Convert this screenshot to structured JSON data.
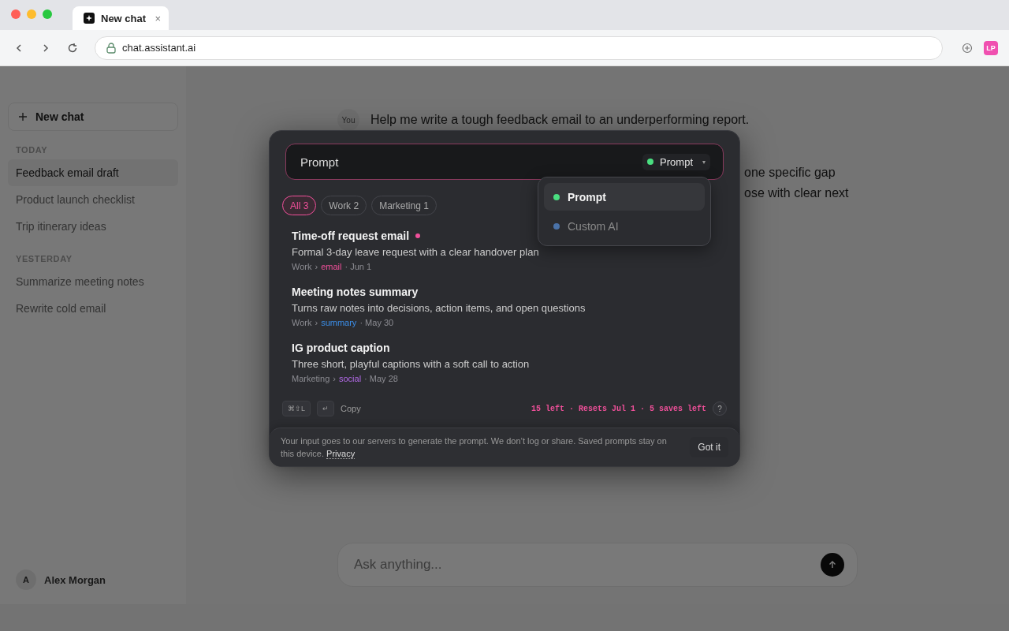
{
  "browser": {
    "tab_title": "New chat",
    "tab_close": "×",
    "url": "chat.assistant.ai",
    "extension_label": "LP"
  },
  "sidebar": {
    "new_chat": "New chat",
    "sections": [
      {
        "heading": "TODAY",
        "items": [
          {
            "label": "Feedback email draft",
            "selected": true
          },
          {
            "label": "Product launch checklist",
            "selected": false
          },
          {
            "label": "Trip itinerary ideas",
            "selected": false
          }
        ]
      },
      {
        "heading": "YESTERDAY",
        "items": [
          {
            "label": "Summarize meeting notes",
            "selected": false
          },
          {
            "label": "Rewrite cold email",
            "selected": false
          }
        ]
      }
    ],
    "user": {
      "initial": "A",
      "name": "Alex Morgan"
    }
  },
  "chat": {
    "message": {
      "avatar": "You",
      "text": "Help me write a tough feedback email to an underperforming report."
    },
    "reply_fragments": [
      "one specific gap",
      "ose with clear next"
    ],
    "composer": {
      "placeholder": "Ask anything..."
    }
  },
  "modal": {
    "search": {
      "value": "Prompt"
    },
    "mode_select": {
      "label": "Prompt",
      "caret": "▾",
      "color": "#4ade80",
      "expanded": true
    },
    "mode_options": [
      {
        "label": "Prompt",
        "color": "#4ade80",
        "selected": true
      },
      {
        "label": "Custom AI",
        "color": "#4a72a8",
        "selected": false
      }
    ],
    "filters": [
      {
        "label": "All 3",
        "selected": true
      },
      {
        "label": "Work 2",
        "selected": false
      },
      {
        "label": "Marketing 1",
        "selected": false
      }
    ],
    "prompts": [
      {
        "title": "Time-off request email",
        "unread": true,
        "description": "Formal 3-day leave request with a clear handover plan",
        "folder": "Work",
        "separator": "›",
        "tag": "email",
        "color": "#f0509a",
        "date": "· Jun 1"
      },
      {
        "title": "Meeting notes summary",
        "unread": false,
        "description": "Turns raw notes into decisions, action items, and open questions",
        "folder": "Work",
        "separator": "›",
        "tag": "summary",
        "color": "#3b8ee8",
        "date": "· May 30"
      },
      {
        "title": "IG product caption",
        "unread": false,
        "description": "Three short, playful captions with a soft call to action",
        "folder": "Marketing",
        "separator": "›",
        "tag": "social",
        "color": "#b36ae8",
        "date": "· May 28"
      }
    ],
    "footer": {
      "shortcut": "⌘⇧L",
      "enter_key": "↵",
      "copy": "Copy",
      "quota": "15 left · Resets Jul 1 · 5 saves left",
      "help": "?"
    },
    "notice": {
      "text": "Your input goes to our servers to generate the prompt. We don’t log or share. Saved prompts stay on this device.",
      "link": "Privacy",
      "button": "Got it"
    }
  }
}
